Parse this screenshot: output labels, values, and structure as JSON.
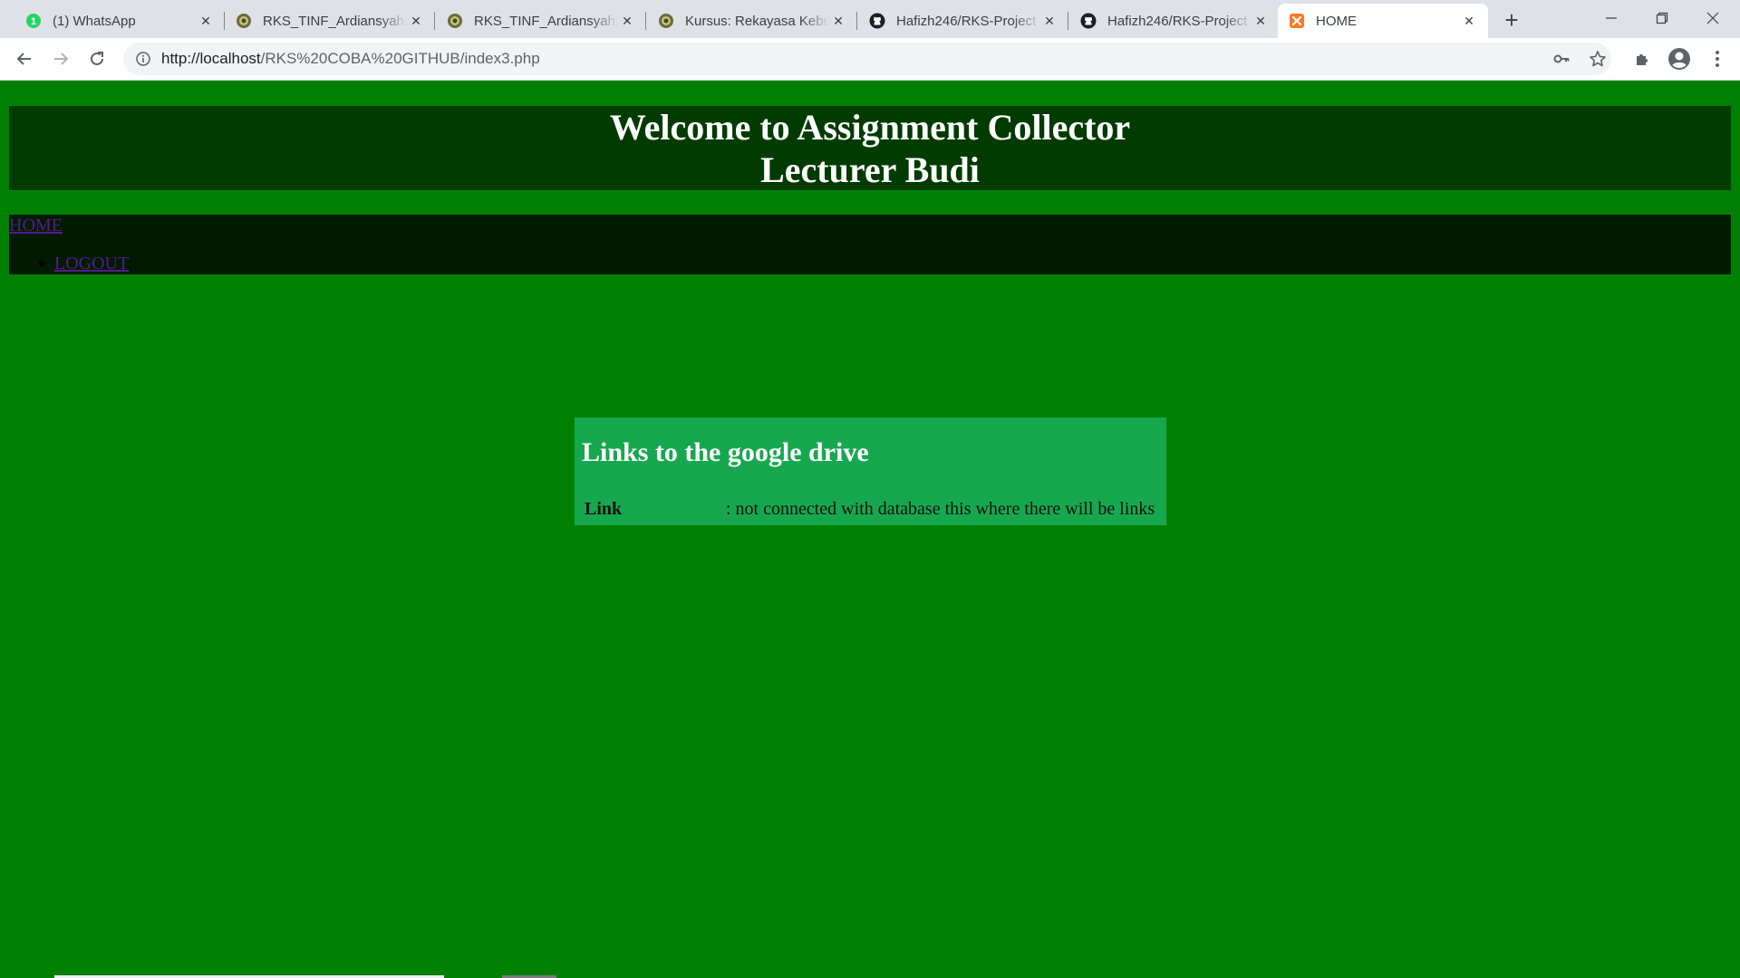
{
  "browser": {
    "tabs": [
      {
        "title": "(1) WhatsApp",
        "icon": "whatsapp-icon",
        "active": false
      },
      {
        "title": "RKS_TINF_Ardiansyah: Topik",
        "icon": "university-icon",
        "active": false
      },
      {
        "title": "RKS_TINF_Ardiansyah: Topik",
        "icon": "university-icon",
        "active": false
      },
      {
        "title": "Kursus: Rekayasa Kebutuhan",
        "icon": "university-icon",
        "active": false
      },
      {
        "title": "Hafizh246/RKS-Project",
        "icon": "github-icon",
        "active": false
      },
      {
        "title": "Hafizh246/RKS-Project",
        "icon": "github-icon",
        "active": false
      },
      {
        "title": "HOME",
        "icon": "xampp-icon",
        "active": true
      }
    ],
    "address": {
      "host": "http://localhost",
      "path": "/RKS%20COBA%20GITHUB/index3.php"
    },
    "colors": {
      "tabstrip": "#dee1e6",
      "toolbar": "#ffffff",
      "omnibox": "#f1f3f4"
    }
  },
  "page": {
    "header": {
      "line1": "Welcome to Assignment Collector",
      "line2": "Lecturer Budi"
    },
    "nav": {
      "home_label": "HOME",
      "logout_label": "LOGOUT"
    },
    "card": {
      "title": "Links to the google drive",
      "row_label": "Link",
      "row_value": ": not connected with database this where there will be links"
    },
    "colors": {
      "background": "#008000",
      "header_bg": "#003b00",
      "nav_bg": "#001b00",
      "card_bg": "#17a84f",
      "link": "#551a8b"
    }
  }
}
